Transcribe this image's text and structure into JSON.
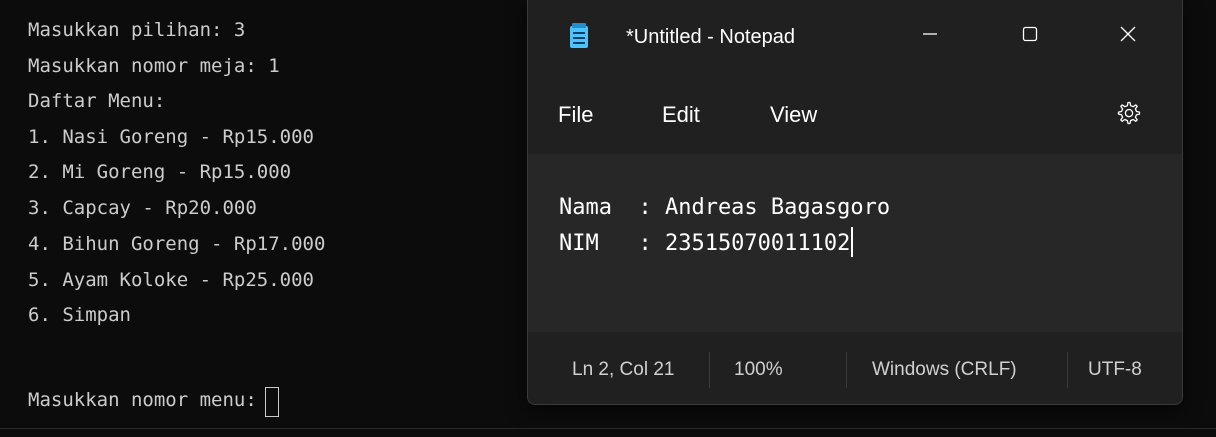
{
  "terminal": {
    "lines": [
      "Masukkan pilihan: 3",
      "Masukkan nomor meja: 1",
      "Daftar Menu:",
      "1. Nasi Goreng - Rp15.000",
      "2. Mi Goreng - Rp15.000",
      "3. Capcay - Rp20.000",
      "4. Bihun Goreng - Rp17.000",
      "5. Ayam Koloke - Rp25.000",
      "6. Simpan"
    ],
    "prompt": "Masukkan nomor menu:"
  },
  "notepad": {
    "title": "*Untitled - Notepad",
    "menu": {
      "file": "File",
      "edit": "Edit",
      "view": "View"
    },
    "content": {
      "line1": "Nama  : Andreas Bagasgoro",
      "line2": "NIM   : 23515070011102"
    },
    "status": {
      "position": "Ln 2, Col 21",
      "zoom": "100%",
      "line_ending": "Windows (CRLF)",
      "encoding": "UTF-8"
    },
    "icons": {
      "app": "notepad-icon",
      "minimize": "minimize-icon",
      "maximize": "maximize-icon",
      "close": "close-icon",
      "settings": "gear-icon"
    },
    "colors": {
      "window_bg": "#202020",
      "editor_bg": "#272727",
      "icon_accent": "#4cc2ff"
    }
  }
}
